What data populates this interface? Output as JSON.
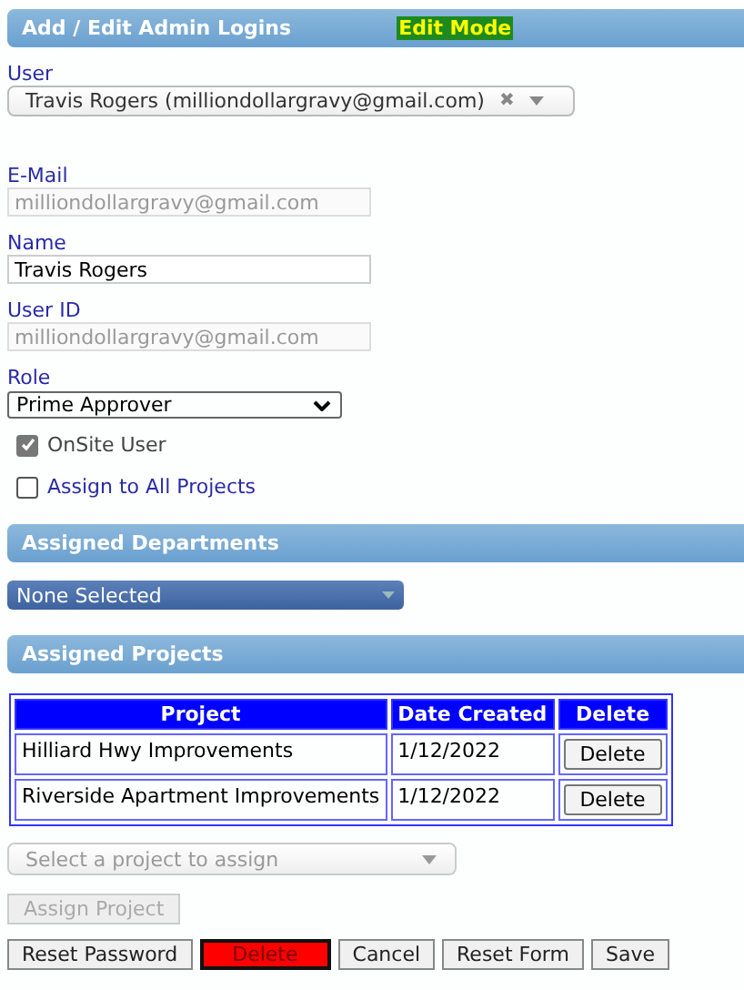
{
  "header": {
    "title": "Add / Edit Admin Logins",
    "mode": "Edit Mode"
  },
  "user": {
    "label": "User",
    "value": "Travis Rogers (milliondollargravy@gmail.com)",
    "clear": "✖"
  },
  "fields": [
    {
      "label": "E-Mail",
      "value": "milliondollargravy@gmail.com",
      "disabled": true
    },
    {
      "label": "Name",
      "value": "Travis Rogers",
      "disabled": false
    },
    {
      "label": "User ID",
      "value": "milliondollargravy@gmail.com",
      "disabled": true
    }
  ],
  "role": {
    "label": "Role",
    "value": "Prime Approver"
  },
  "checkboxes": [
    {
      "label": "OnSite User",
      "checked": true
    },
    {
      "label": "Assign to All Projects",
      "checked": false
    }
  ],
  "departments": {
    "title": "Assigned Departments",
    "value": "None Selected"
  },
  "projects": {
    "title": "Assigned Projects",
    "columns": [
      "Project",
      "Date Created",
      "Delete"
    ],
    "rows": [
      {
        "project": "Hilliard Hwy Improvements",
        "date": "1/12/2022",
        "action": "Delete"
      },
      {
        "project": "Riverside Apartment Improvements",
        "date": "1/12/2022",
        "action": "Delete"
      }
    ],
    "placeholder": "Select a project to assign",
    "assign": {
      "label": "Assign Project",
      "disabled": true
    }
  },
  "buttons": [
    {
      "label": "Reset Password",
      "kind": "normal"
    },
    {
      "label": "Delete",
      "kind": "danger"
    },
    {
      "label": "Cancel",
      "kind": "normal"
    },
    {
      "label": "Reset Form",
      "kind": "normal"
    },
    {
      "label": "Save",
      "kind": "normal"
    }
  ]
}
